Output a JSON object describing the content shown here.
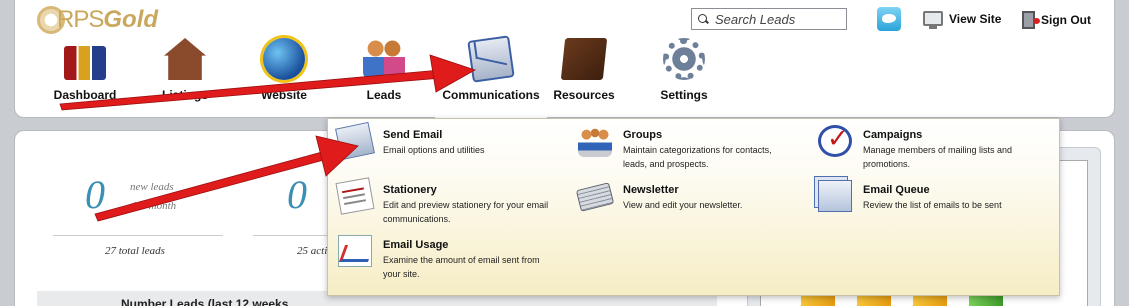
{
  "header": {
    "logo_rps": "RPS",
    "logo_gold": "Gold",
    "search_placeholder": "Search Leads",
    "view_site": "View Site",
    "sign_out": "Sign Out"
  },
  "nav": {
    "items": [
      {
        "label": "Dashboard",
        "icon": "bar-chart-icon"
      },
      {
        "label": "Listings",
        "icon": "house-icon"
      },
      {
        "label": "Website",
        "icon": "globe-icon"
      },
      {
        "label": "Leads",
        "icon": "people-icon"
      },
      {
        "label": "Communications",
        "icon": "envelope-icon",
        "active": true
      },
      {
        "label": "Resources",
        "icon": "book-icon"
      },
      {
        "label": "Settings",
        "icon": "gear-icon"
      }
    ]
  },
  "dropdown": {
    "items": [
      {
        "title": "Send Email",
        "desc": "Email options and utilities"
      },
      {
        "title": "Stationery",
        "desc": "Edit and preview stationery for your email communications."
      },
      {
        "title": "Email Usage",
        "desc": "Examine the amount of email sent from your site."
      },
      {
        "title": "Groups",
        "desc": "Maintain categorizations for contacts, leads, and prospects."
      },
      {
        "title": "Newsletter",
        "desc": "View and edit your newsletter."
      },
      {
        "title": "Campaigns",
        "desc": "Manage members of mailing lists and promotions."
      },
      {
        "title": "Email Queue",
        "desc": "Review the list of emails to be sent"
      }
    ]
  },
  "stats": {
    "leads_value": "0",
    "leads_caption_1": "new leads",
    "leads_caption_2": "this month",
    "leads_total": "27 total leads",
    "second_value": "0",
    "second_total": "25 acti"
  },
  "bottom_bar": {
    "label": "Number Leads (last 12 weeks"
  },
  "colors": {
    "accent": "#3b8fb4",
    "annotation_arrow": "#e01b1b",
    "dropdown_bg_end": "#f6edc5"
  }
}
